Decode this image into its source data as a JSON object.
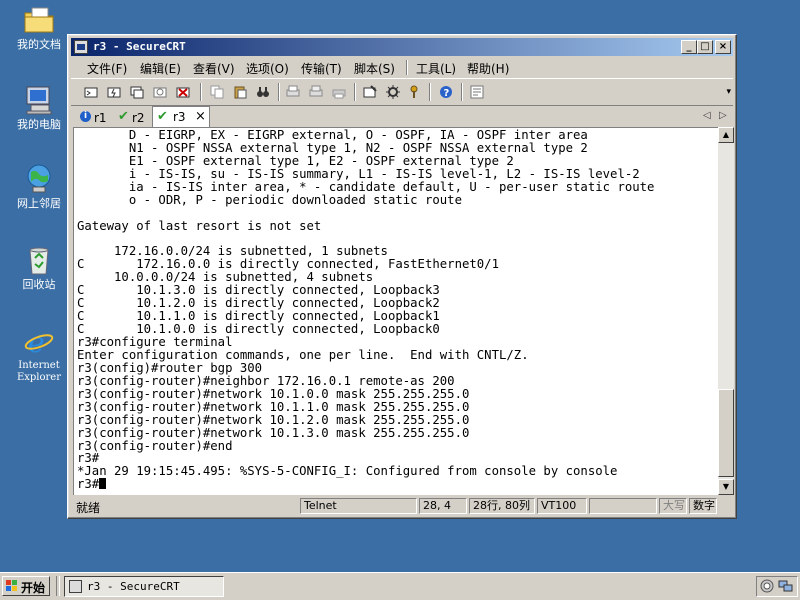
{
  "desktop": {
    "icons": [
      {
        "label": "我的文档"
      },
      {
        "label": "我的电脑"
      },
      {
        "label": "网上邻居"
      },
      {
        "label": "回收站"
      },
      {
        "label": "Internet Explorer"
      }
    ]
  },
  "window": {
    "title": "r3 - SecureCRT",
    "buttons": {
      "minimize": "_",
      "maximize": "□",
      "close": "×"
    }
  },
  "menu": {
    "items": [
      "文件(F)",
      "编辑(E)",
      "查看(V)",
      "选项(O)",
      "传输(T)",
      "脚本(S)",
      "工具(L)",
      "帮助(H)"
    ]
  },
  "tabs": {
    "items": [
      {
        "label": "r1",
        "status": "info"
      },
      {
        "label": "r2",
        "status": "connected"
      },
      {
        "label": "r3",
        "status": "connected",
        "active": true
      }
    ],
    "close_glyph": "×",
    "prev_glyph": "◁",
    "next_glyph": "▷"
  },
  "terminal": {
    "lines": [
      "       D - EIGRP, EX - EIGRP external, O - OSPF, IA - OSPF inter area",
      "       N1 - OSPF NSSA external type 1, N2 - OSPF NSSA external type 2",
      "       E1 - OSPF external type 1, E2 - OSPF external type 2",
      "       i - IS-IS, su - IS-IS summary, L1 - IS-IS level-1, L2 - IS-IS level-2",
      "       ia - IS-IS inter area, * - candidate default, U - per-user static route",
      "       o - ODR, P - periodic downloaded static route",
      "",
      "Gateway of last resort is not set",
      "",
      "     172.16.0.0/24 is subnetted, 1 subnets",
      "C       172.16.0.0 is directly connected, FastEthernet0/1",
      "     10.0.0.0/24 is subnetted, 4 subnets",
      "C       10.1.3.0 is directly connected, Loopback3",
      "C       10.1.2.0 is directly connected, Loopback2",
      "C       10.1.1.0 is directly connected, Loopback1",
      "C       10.1.0.0 is directly connected, Loopback0",
      "r3#configure terminal",
      "Enter configuration commands, one per line.  End with CNTL/Z.",
      "r3(config)#router bgp 300",
      "r3(config-router)#neighbor 172.16.0.1 remote-as 200",
      "r3(config-router)#network 10.1.0.0 mask 255.255.255.0",
      "r3(config-router)#network 10.1.1.0 mask 255.255.255.0",
      "r3(config-router)#network 10.1.2.0 mask 255.255.255.0",
      "r3(config-router)#network 10.1.3.0 mask 255.255.255.0",
      "r3(config-router)#end",
      "r3#",
      "*Jan 29 19:15:45.495: %SYS-5-CONFIG_I: Configured from console by console"
    ],
    "prompt": "r3#"
  },
  "status": {
    "ready": "就绪",
    "protocol": "Telnet",
    "cursor_pos": "28,  4",
    "size": "28行, 80列",
    "emulation": "VT100",
    "caps": "大写",
    "num": "数字"
  },
  "taskbar": {
    "start_label": "开始",
    "task_label": "r3 - SecureCRT"
  },
  "colors": {
    "desktop": "#3a6ea5",
    "title_active": "#0a246a",
    "check_green": "#2e9b2e",
    "info_blue": "#1e5fc8"
  }
}
